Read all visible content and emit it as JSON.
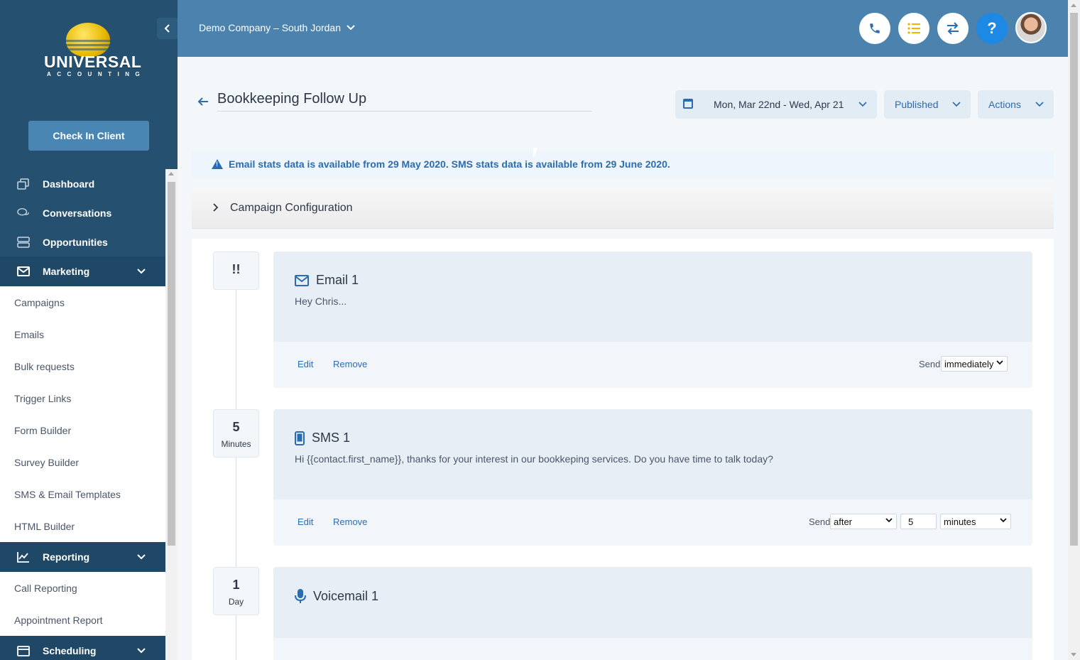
{
  "sidebar": {
    "logo_text": "UNIVERSAL",
    "logo_sub": "ACCOUNTING",
    "checkin_label": "Check In Client",
    "nav": {
      "dashboard": "Dashboard",
      "conversations": "Conversations",
      "opportunities": "Opportunities",
      "marketing": "Marketing",
      "reporting": "Reporting",
      "scheduling": "Scheduling"
    },
    "marketing_items": [
      "Campaigns",
      "Emails",
      "Bulk requests",
      "Trigger Links",
      "Form Builder",
      "Survey Builder",
      "SMS & Email Templates",
      "HTML Builder"
    ],
    "reporting_items": [
      "Call Reporting",
      "Appointment Report"
    ]
  },
  "header": {
    "company": "Demo Company – South Jordan",
    "help_label": "?"
  },
  "campaign": {
    "title": "Bookkeeping Follow Up",
    "date_range": "Mon, Mar 22nd - Wed, Apr 21",
    "status": "Published",
    "actions": "Actions",
    "alert": "Email stats data is available from 29 May 2020. SMS stats data is available from 29 June 2020.",
    "config_label": "Campaign Configuration"
  },
  "steps": [
    {
      "badge_num": "!!",
      "badge_unit": "",
      "title": "Email 1",
      "body": "Hey Chris...",
      "edit": "Edit",
      "remove": "Remove",
      "send_label": "Send",
      "send_when": "immediately"
    },
    {
      "badge_num": "5",
      "badge_unit": "Minutes",
      "title": "SMS 1",
      "body": "Hi {{contact.first_name}}, thanks for your interest in our bookkeping services. Do you have time to talk today?",
      "edit": "Edit",
      "remove": "Remove",
      "send_label": "Send",
      "send_when": "after",
      "send_amount": "5",
      "send_unit": "minutes"
    },
    {
      "badge_num": "1",
      "badge_unit": "Day",
      "title": "Voicemail 1"
    }
  ],
  "colors": {
    "sidebar_bg": "#25506f",
    "header_bg": "#4b83ae",
    "accent": "#2b6cb0",
    "help_btn": "#1e88e5"
  }
}
